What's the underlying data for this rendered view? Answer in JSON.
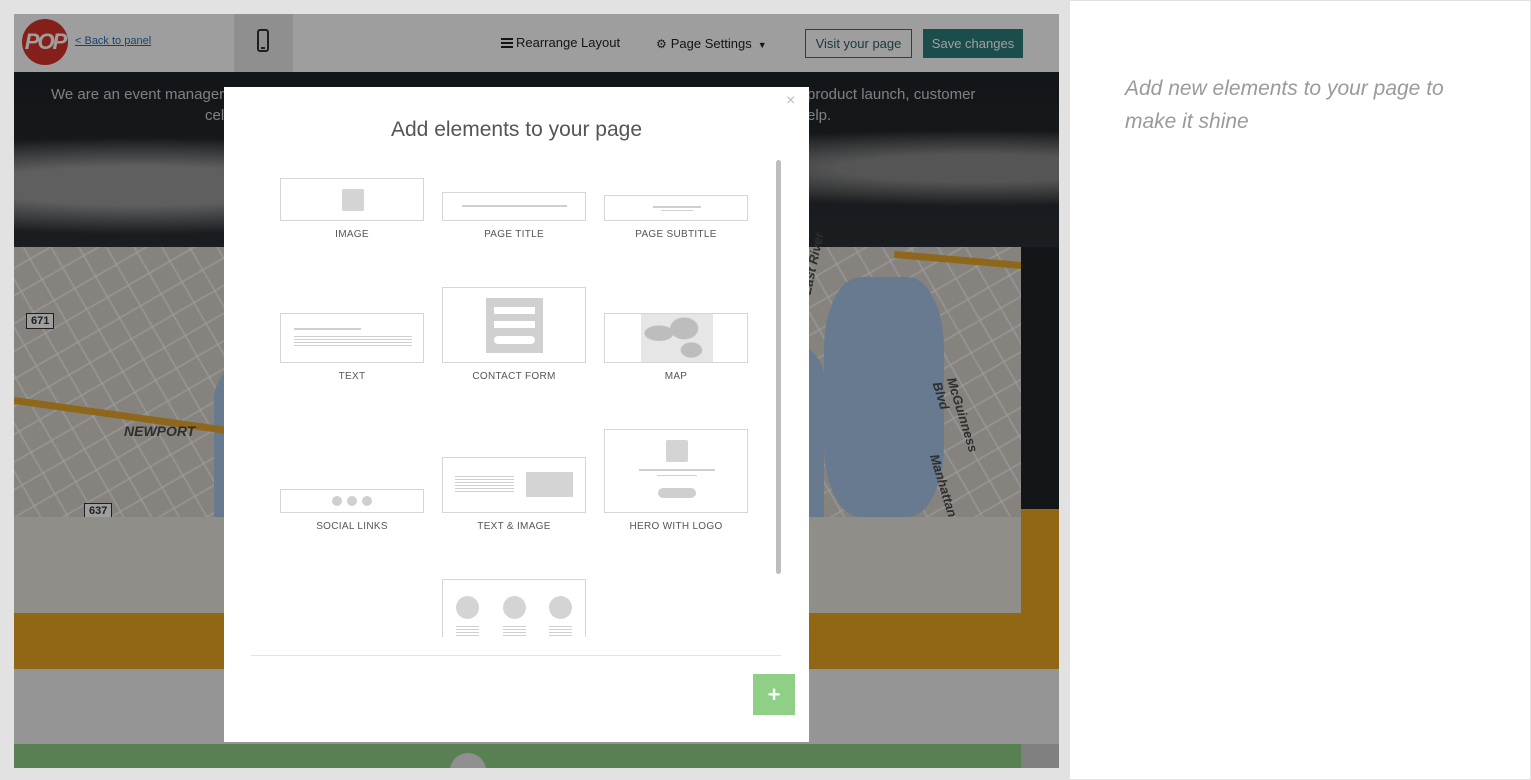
{
  "topbar": {
    "logo_text": "POP",
    "back_link": "< Back to panel",
    "rearrange_label": "Rearrange Layout",
    "page_settings_label": "Page Settings",
    "visit_label": "Visit your page",
    "save_label": "Save changes"
  },
  "hero": {
    "line1_left": "We are an event manager",
    "line2_left": "cele",
    "line1_right": "product launch, customer",
    "line2_right": "elp."
  },
  "map": {
    "labels": [
      "NEWPORT",
      "East River",
      "McGuinness Blvd",
      "Manhattan"
    ],
    "shields": [
      "671",
      "637"
    ]
  },
  "modal": {
    "title": "Add elements to your page",
    "close_glyph": "×",
    "add_glyph": "+",
    "items": [
      {
        "label": "IMAGE"
      },
      {
        "label": "PAGE TITLE"
      },
      {
        "label": "PAGE SUBTITLE"
      },
      {
        "label": "TEXT"
      },
      {
        "label": "CONTACT FORM"
      },
      {
        "label": "MAP"
      },
      {
        "label": "SOCIAL LINKS"
      },
      {
        "label": "TEXT & IMAGE"
      },
      {
        "label": "HERO WITH LOGO"
      }
    ]
  },
  "panel": {
    "hint": "Add new elements to your page to make it shine"
  },
  "colors": {
    "accent": "#2e7c7c",
    "add_button": "#8fcf86",
    "brand_red": "#d6322b",
    "gold": "#e8a823"
  }
}
